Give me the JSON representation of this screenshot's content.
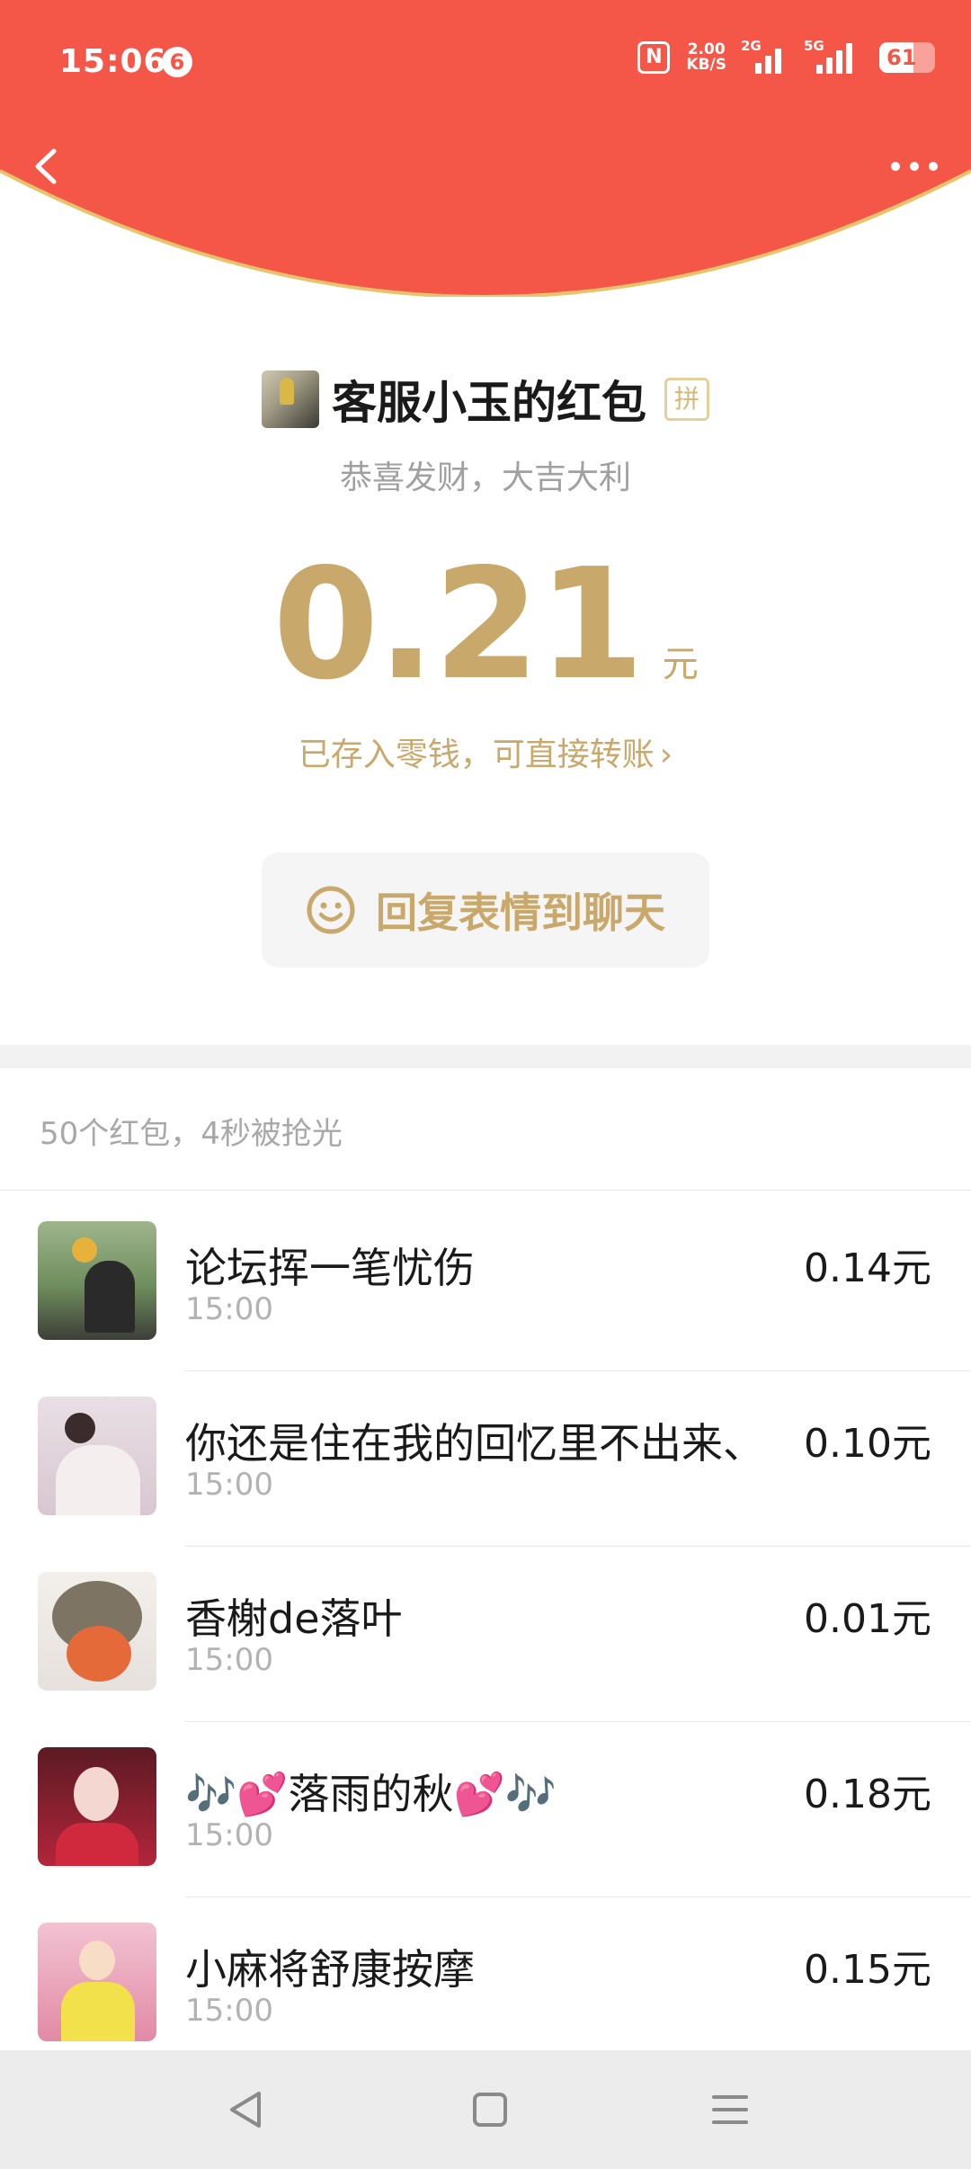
{
  "status_bar": {
    "time": "15:06",
    "notification_count": "6",
    "nfc_label": "N",
    "net_speed_value": "2.00",
    "net_speed_unit": "KB/S",
    "sim1_label": "2G",
    "sim2_label": "5G",
    "battery_percent": "61",
    "battery_level": 0.61
  },
  "colors": {
    "header_red": "#F45648",
    "gold": "#C9A86B",
    "gold_border": "#E6CF9C"
  },
  "icons": {
    "back": "chevron-left-icon",
    "more": "more-dots-icon",
    "smile": "smile-icon",
    "nav_back": "triangle-back-icon",
    "nav_home": "square-home-icon",
    "nav_menu": "hamburger-menu-icon"
  },
  "envelope": {
    "sender_title": "客服小玉的红包",
    "pin_badge": "拼",
    "greeting": "恭喜发财，大吉大利",
    "amount": "0.21",
    "unit": "元",
    "saved_note": "已存入零钱，可直接转账",
    "saved_chevron": "›",
    "reply_button": "回复表情到聊天"
  },
  "summary": "50个红包，4秒被抢光",
  "recipients": [
    {
      "name": "论坛挥一笔忧伤",
      "time": "15:00",
      "amount": "0.14元"
    },
    {
      "name": "你还是住在我的回忆里不出来、",
      "time": "15:00",
      "amount": "0.10元"
    },
    {
      "name": "香榭de落叶",
      "time": "15:00",
      "amount": "0.01元"
    },
    {
      "name": "🎶💕落雨的秋💕🎶",
      "time": "15:00",
      "amount": "0.18元"
    },
    {
      "name": "小麻将舒康按摩",
      "time": "15:00",
      "amount": "0.15元"
    }
  ]
}
